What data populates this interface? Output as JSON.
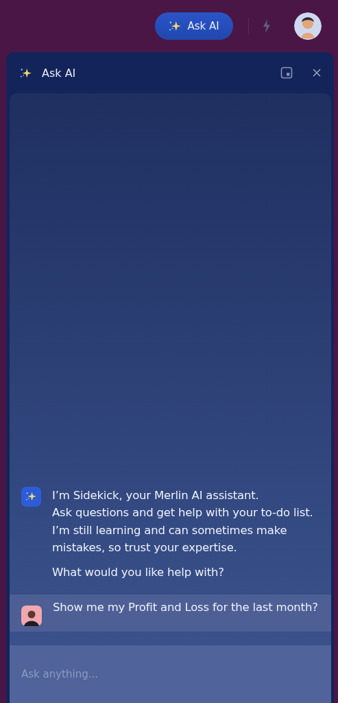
{
  "topbar": {
    "ask_button": {
      "label": "Ask AI"
    }
  },
  "panel": {
    "title": "Ask AI"
  },
  "messages": [
    {
      "kind": "assistant",
      "paragraphs": [
        "I’m Sidekick, your Merlin AI assistant.",
        "Ask questions and get help with your to-do list.",
        "I’m still learning and can sometimes make mistakes, so trust your expertise."
      ],
      "question": "What would you like help with?"
    },
    {
      "kind": "user",
      "paragraphs": [
        "Show me my Profit and Loss for the last month?"
      ]
    }
  ],
  "composer": {
    "placeholder": "Ask anything..."
  }
}
